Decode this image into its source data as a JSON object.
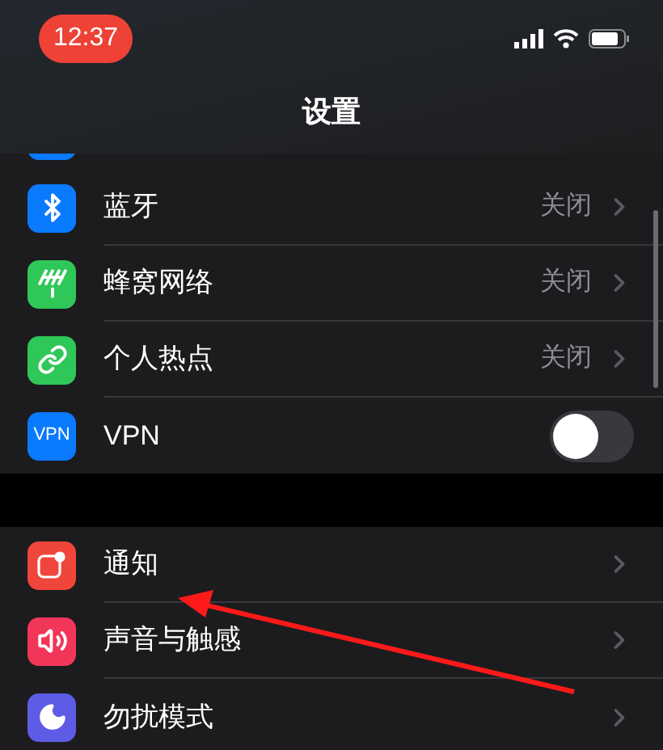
{
  "status_bar": {
    "time": "12:37"
  },
  "title": "设置",
  "groups": [
    {
      "items": [
        {
          "kind": "link",
          "color": "#0a7aff",
          "label": "蓝牙",
          "value": "关闭"
        },
        {
          "kind": "link",
          "color": "#30c759",
          "label": "蜂窝网络",
          "value": "关闭"
        },
        {
          "kind": "link",
          "color": "#30c759",
          "label": "个人热点",
          "value": "关闭"
        },
        {
          "kind": "toggle",
          "icon_text": "VPN",
          "color": "#0a7aff",
          "label": "VPN",
          "on": false
        }
      ]
    },
    {
      "items": [
        {
          "kind": "link",
          "color": "#f0453a",
          "label": "通知"
        },
        {
          "kind": "link",
          "color": "#f2365a",
          "label": "声音与触感"
        },
        {
          "kind": "link",
          "color": "#5e5ce6",
          "label": "勿扰模式"
        }
      ]
    }
  ]
}
